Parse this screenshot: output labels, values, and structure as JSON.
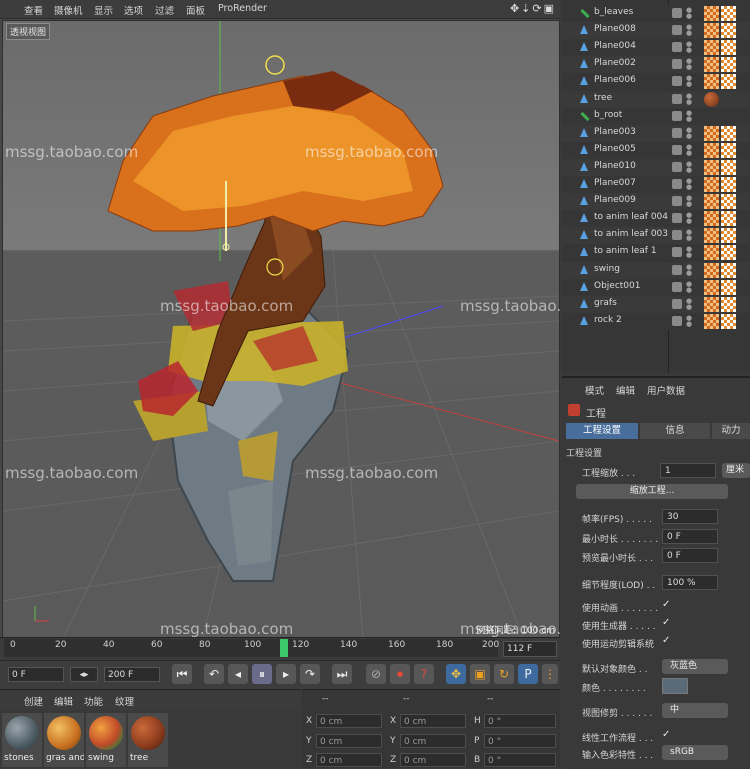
{
  "menu": [
    "查看",
    "摄像机",
    "显示",
    "选项",
    "过滤",
    "面板",
    "ProRender"
  ],
  "viewport": {
    "label": "透视视图",
    "grid_info": "网格间距：100 cm"
  },
  "watermark": "mssg.taobao.com",
  "timeline": {
    "ticks": [
      "0",
      "20",
      "40",
      "60",
      "80",
      "100",
      "120",
      "140",
      "160",
      "180",
      "200"
    ],
    "current_frame": "112 F",
    "current_value": 112
  },
  "transport": {
    "start_field": "0 F",
    "end_field": "200 F"
  },
  "materials": {
    "menu": [
      "创建",
      "编辑",
      "功能",
      "纹理"
    ],
    "items": [
      {
        "label": "stones",
        "color": "#5e6f78"
      },
      {
        "label": "gras and",
        "color": "#d9872a"
      },
      {
        "label": "swing",
        "color": "#d06030"
      },
      {
        "label": "tree",
        "color": "#8b3a1c"
      }
    ]
  },
  "coords": {
    "header": [
      "--",
      "--",
      "--"
    ],
    "rows": [
      {
        "a": "X",
        "av": "0 cm",
        "b": "X",
        "bv": "0 cm",
        "c": "H",
        "cv": "0 °"
      },
      {
        "a": "Y",
        "av": "0 cm",
        "b": "Y",
        "bv": "0 cm",
        "c": "P",
        "cv": "0 °"
      },
      {
        "a": "Z",
        "av": "0 cm",
        "b": "Z",
        "bv": "0 cm",
        "c": "B",
        "cv": "0 °"
      }
    ]
  },
  "objects": [
    {
      "name": "b_leaves",
      "icon": "bone",
      "tags": 2
    },
    {
      "name": "Plane008",
      "icon": "poly",
      "tags": 2
    },
    {
      "name": "Plane004",
      "icon": "poly",
      "tags": 2
    },
    {
      "name": "Plane002",
      "icon": "poly",
      "tags": 2
    },
    {
      "name": "Plane006",
      "icon": "poly",
      "tags": 2
    },
    {
      "name": "tree",
      "icon": "poly",
      "tags": 1
    },
    {
      "name": "b_root",
      "icon": "bone",
      "tags": 0
    },
    {
      "name": "Plane003",
      "icon": "poly",
      "tags": 2
    },
    {
      "name": "Plane005",
      "icon": "poly",
      "tags": 2
    },
    {
      "name": "Plane010",
      "icon": "poly",
      "tags": 2
    },
    {
      "name": "Plane007",
      "icon": "poly",
      "tags": 2
    },
    {
      "name": "Plane009",
      "icon": "poly",
      "tags": 2
    },
    {
      "name": "to anim leaf 004",
      "icon": "poly",
      "tags": 2
    },
    {
      "name": "to anim leaf 003",
      "icon": "poly",
      "tags": 2
    },
    {
      "name": "to anim leaf 1",
      "icon": "poly",
      "tags": 2
    },
    {
      "name": "swing",
      "icon": "poly",
      "tags": 2
    },
    {
      "name": "Object001",
      "icon": "poly",
      "tags": 2
    },
    {
      "name": "grafs",
      "icon": "poly",
      "tags": 2
    },
    {
      "name": "rock 2",
      "icon": "poly",
      "tags": 2
    }
  ],
  "attributes": {
    "menu": [
      "模式",
      "编辑",
      "用户数据"
    ],
    "title": "工程",
    "tabs": [
      "工程设置",
      "信息",
      "动力"
    ],
    "section": "工程设置",
    "scale_label": "工程缩放 . . .",
    "scale_value": "1",
    "scale_unit": "厘米",
    "scale_button": "缩放工程...",
    "fields": [
      {
        "label": "帧率(FPS) . . . . .",
        "value": "30"
      },
      {
        "label": "最小时长 . . . . . . .",
        "value": "0 F"
      },
      {
        "label": "预览最小时长 . . .",
        "value": "0 F"
      }
    ],
    "lod_label": "细节程度(LOD) . .",
    "lod_value": "100 %",
    "checks": [
      {
        "label": "使用动画 . . . . . . .",
        "mark": "✓"
      },
      {
        "label": "使用生成器 . . . . .",
        "mark": "✓"
      },
      {
        "label": "使用运动剪辑系统",
        "mark": "✓"
      }
    ],
    "default_color_label": "默认对象颜色 . .",
    "default_color_value": "灰蓝色",
    "color_label": "颜色 . . . . . . . .",
    "view_clip_label": "视图修剪 . . . . . .",
    "view_clip_value": "中",
    "linear_label": "线性工作流程 . . .",
    "linear_mark": "✓",
    "input_color_label": "输入色彩特性 . . .",
    "input_color_value": "sRGB"
  }
}
